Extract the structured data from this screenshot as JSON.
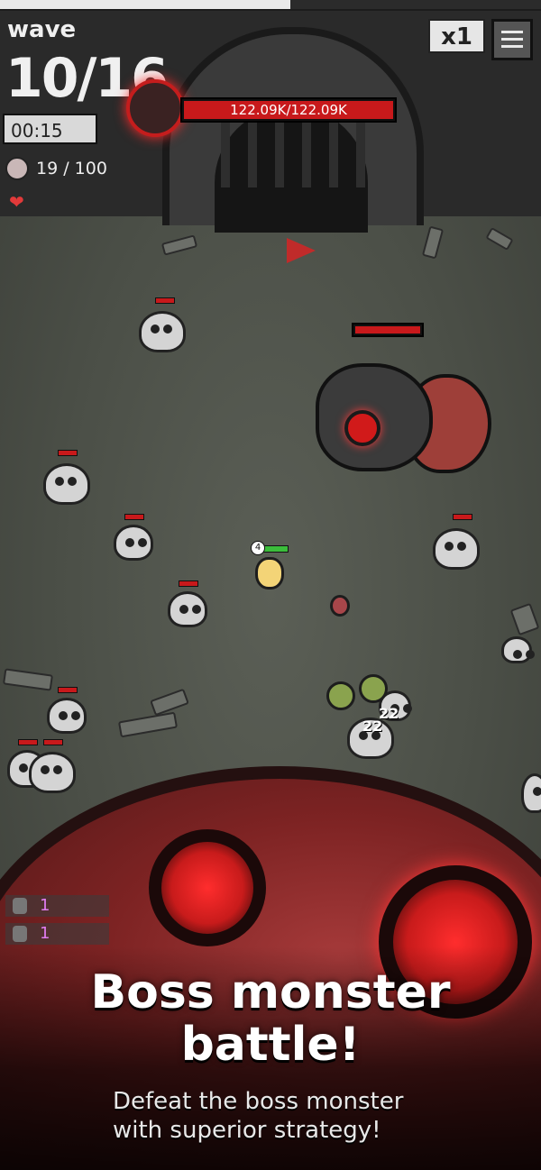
{
  "hud": {
    "wave_label": "wave",
    "wave_value": "10/16",
    "timer": "00:15",
    "kills": "19 / 100",
    "speed": "x1"
  },
  "boss": {
    "hp_text": "122.09K/122.09K",
    "hp_fraction": 1.0
  },
  "player": {
    "level": "4"
  },
  "damage_numbers": [
    "22",
    "22"
  ],
  "items": [
    {
      "icon": "gem-icon",
      "count": "1"
    },
    {
      "icon": "bag-icon",
      "count": "1"
    }
  ],
  "promo": {
    "title_line1": "Boss monster",
    "title_line2": "battle!",
    "subtitle_line1": "Defeat the boss monster",
    "subtitle_line2": "with superior strategy!"
  },
  "colors": {
    "boss_hp": "#c8191b",
    "player_hp": "#3bbd3b",
    "item_count": "#e07cf0"
  }
}
